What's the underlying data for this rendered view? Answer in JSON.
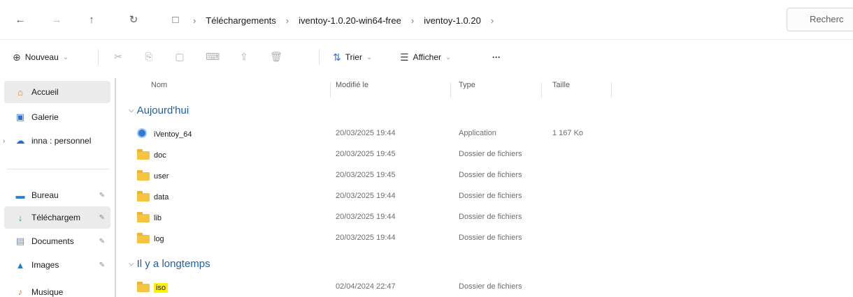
{
  "nav": {
    "back_icon": "←",
    "forward_icon": "→",
    "up_icon": "↑",
    "refresh_icon": "↻",
    "view_icon": "□",
    "breadcrumbs": [
      "Téléchargements",
      "iventoy-1.0.20-win64-free",
      "iventoy-1.0.20"
    ],
    "search_placeholder": "Recherc"
  },
  "toolbar": {
    "new_label": "Nouveau",
    "sort_label": "Trier",
    "view_label": "Afficher",
    "more_label": "···"
  },
  "sidebar": {
    "items": [
      {
        "label": "Accueil",
        "icon": "home-icon"
      },
      {
        "label": "Galerie",
        "icon": "gallery-icon"
      },
      {
        "label": "inna : personnel",
        "icon": "cloud-icon"
      },
      {
        "label": "Bureau",
        "icon": "desktop-icon"
      },
      {
        "label": "Téléchargem",
        "icon": "download-icon"
      },
      {
        "label": "Documents",
        "icon": "documents-icon"
      },
      {
        "label": "Images",
        "icon": "images-icon"
      },
      {
        "label": "Musique",
        "icon": "music-icon"
      }
    ]
  },
  "columns": {
    "name": "Nom",
    "modified": "Modifié le",
    "type": "Type",
    "size": "Taille"
  },
  "groups": {
    "today": "Aujourd'hui",
    "long_ago": "Il y a longtemps"
  },
  "files_today": [
    {
      "name": "iVentoy_64",
      "date": "20/03/2025 19:44",
      "type": "Application",
      "size": "1 167 Ko",
      "kind": "app"
    },
    {
      "name": "doc",
      "date": "20/03/2025 19:45",
      "type": "Dossier de fichiers",
      "size": "",
      "kind": "folder"
    },
    {
      "name": "user",
      "date": "20/03/2025 19:45",
      "type": "Dossier de fichiers",
      "size": "",
      "kind": "folder"
    },
    {
      "name": "data",
      "date": "20/03/2025 19:44",
      "type": "Dossier de fichiers",
      "size": "",
      "kind": "folder"
    },
    {
      "name": "lib",
      "date": "20/03/2025 19:44",
      "type": "Dossier de fichiers",
      "size": "",
      "kind": "folder"
    },
    {
      "name": "log",
      "date": "20/03/2025 19:44",
      "type": "Dossier de fichiers",
      "size": "",
      "kind": "folder"
    }
  ],
  "files_old": [
    {
      "name": "iso",
      "date": "02/04/2024 22:47",
      "type": "Dossier de fichiers",
      "size": "",
      "kind": "folder"
    }
  ],
  "colors": {
    "highlight": "#fff200",
    "group_heading": "#1f5fa8",
    "folder": "#f5c542"
  }
}
